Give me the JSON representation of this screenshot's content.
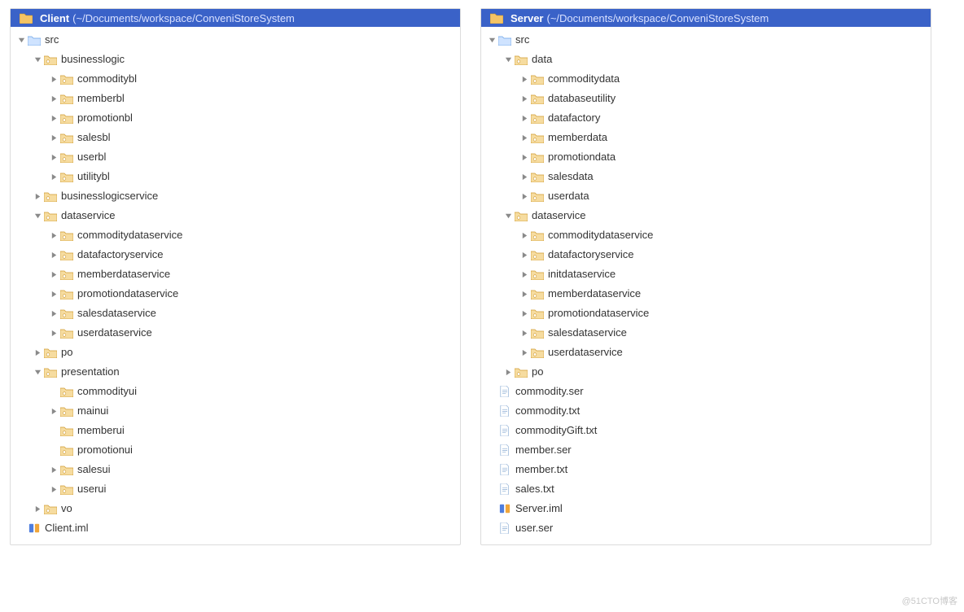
{
  "watermark": "@51CTO博客",
  "panes": [
    {
      "id": "client",
      "header": {
        "name": "Client",
        "path": " (~/Documents/workspace/ConveniStoreSystem"
      },
      "rows": [
        {
          "kind": "folder",
          "depth": 0,
          "exp": "down",
          "label": "src"
        },
        {
          "kind": "package",
          "depth": 1,
          "exp": "down",
          "label": "businesslogic"
        },
        {
          "kind": "package",
          "depth": 2,
          "exp": "right",
          "label": "commoditybl"
        },
        {
          "kind": "package",
          "depth": 2,
          "exp": "right",
          "label": "memberbl"
        },
        {
          "kind": "package",
          "depth": 2,
          "exp": "right",
          "label": "promotionbl"
        },
        {
          "kind": "package",
          "depth": 2,
          "exp": "right",
          "label": "salesbl"
        },
        {
          "kind": "package",
          "depth": 2,
          "exp": "right",
          "label": "userbl"
        },
        {
          "kind": "package",
          "depth": 2,
          "exp": "right",
          "label": "utilitybl"
        },
        {
          "kind": "package",
          "depth": 1,
          "exp": "right",
          "label": "businesslogicservice"
        },
        {
          "kind": "package",
          "depth": 1,
          "exp": "down",
          "label": "dataservice"
        },
        {
          "kind": "package",
          "depth": 2,
          "exp": "right",
          "label": "commoditydataservice"
        },
        {
          "kind": "package",
          "depth": 2,
          "exp": "right",
          "label": "datafactoryservice"
        },
        {
          "kind": "package",
          "depth": 2,
          "exp": "right",
          "label": "memberdataservice"
        },
        {
          "kind": "package",
          "depth": 2,
          "exp": "right",
          "label": "promotiondataservice"
        },
        {
          "kind": "package",
          "depth": 2,
          "exp": "right",
          "label": "salesdataservice"
        },
        {
          "kind": "package",
          "depth": 2,
          "exp": "right",
          "label": "userdataservice"
        },
        {
          "kind": "package",
          "depth": 1,
          "exp": "right",
          "label": "po"
        },
        {
          "kind": "package",
          "depth": 1,
          "exp": "down",
          "label": "presentation"
        },
        {
          "kind": "package",
          "depth": 2,
          "exp": "none",
          "label": "commodityui"
        },
        {
          "kind": "package",
          "depth": 2,
          "exp": "right",
          "label": "mainui"
        },
        {
          "kind": "package",
          "depth": 2,
          "exp": "none",
          "label": "memberui"
        },
        {
          "kind": "package",
          "depth": 2,
          "exp": "none",
          "label": "promotionui"
        },
        {
          "kind": "package",
          "depth": 2,
          "exp": "right",
          "label": "salesui"
        },
        {
          "kind": "package",
          "depth": 2,
          "exp": "right",
          "label": "userui"
        },
        {
          "kind": "package",
          "depth": 1,
          "exp": "right",
          "label": "vo"
        },
        {
          "kind": "iml",
          "depth": 0,
          "exp": "none",
          "label": "Client.iml"
        }
      ]
    },
    {
      "id": "server",
      "header": {
        "name": "Server",
        "path": " (~/Documents/workspace/ConveniStoreSystem"
      },
      "rows": [
        {
          "kind": "folder",
          "depth": 0,
          "exp": "down",
          "label": "src"
        },
        {
          "kind": "package",
          "depth": 1,
          "exp": "down",
          "label": "data"
        },
        {
          "kind": "package",
          "depth": 2,
          "exp": "right",
          "label": "commoditydata"
        },
        {
          "kind": "package",
          "depth": 2,
          "exp": "right",
          "label": "databaseutility"
        },
        {
          "kind": "package",
          "depth": 2,
          "exp": "right",
          "label": "datafactory"
        },
        {
          "kind": "package",
          "depth": 2,
          "exp": "right",
          "label": "memberdata"
        },
        {
          "kind": "package",
          "depth": 2,
          "exp": "right",
          "label": "promotiondata"
        },
        {
          "kind": "package",
          "depth": 2,
          "exp": "right",
          "label": "salesdata"
        },
        {
          "kind": "package",
          "depth": 2,
          "exp": "right",
          "label": "userdata"
        },
        {
          "kind": "package",
          "depth": 1,
          "exp": "down",
          "label": "dataservice"
        },
        {
          "kind": "package",
          "depth": 2,
          "exp": "right",
          "label": "commoditydataservice"
        },
        {
          "kind": "package",
          "depth": 2,
          "exp": "right",
          "label": "datafactoryservice"
        },
        {
          "kind": "package",
          "depth": 2,
          "exp": "right",
          "label": "initdataservice"
        },
        {
          "kind": "package",
          "depth": 2,
          "exp": "right",
          "label": "memberdataservice"
        },
        {
          "kind": "package",
          "depth": 2,
          "exp": "right",
          "label": "promotiondataservice"
        },
        {
          "kind": "package",
          "depth": 2,
          "exp": "right",
          "label": "salesdataservice"
        },
        {
          "kind": "package",
          "depth": 2,
          "exp": "right",
          "label": "userdataservice"
        },
        {
          "kind": "package",
          "depth": 1,
          "exp": "right",
          "label": "po"
        },
        {
          "kind": "file",
          "depth": 0,
          "exp": "none",
          "label": "commodity.ser"
        },
        {
          "kind": "file",
          "depth": 0,
          "exp": "none",
          "label": "commodity.txt"
        },
        {
          "kind": "file",
          "depth": 0,
          "exp": "none",
          "label": "commodityGift.txt"
        },
        {
          "kind": "file",
          "depth": 0,
          "exp": "none",
          "label": "member.ser"
        },
        {
          "kind": "file",
          "depth": 0,
          "exp": "none",
          "label": "member.txt"
        },
        {
          "kind": "file",
          "depth": 0,
          "exp": "none",
          "label": "sales.txt"
        },
        {
          "kind": "iml",
          "depth": 0,
          "exp": "none",
          "label": "Server.iml"
        },
        {
          "kind": "file",
          "depth": 0,
          "exp": "none",
          "label": "user.ser"
        }
      ]
    }
  ]
}
